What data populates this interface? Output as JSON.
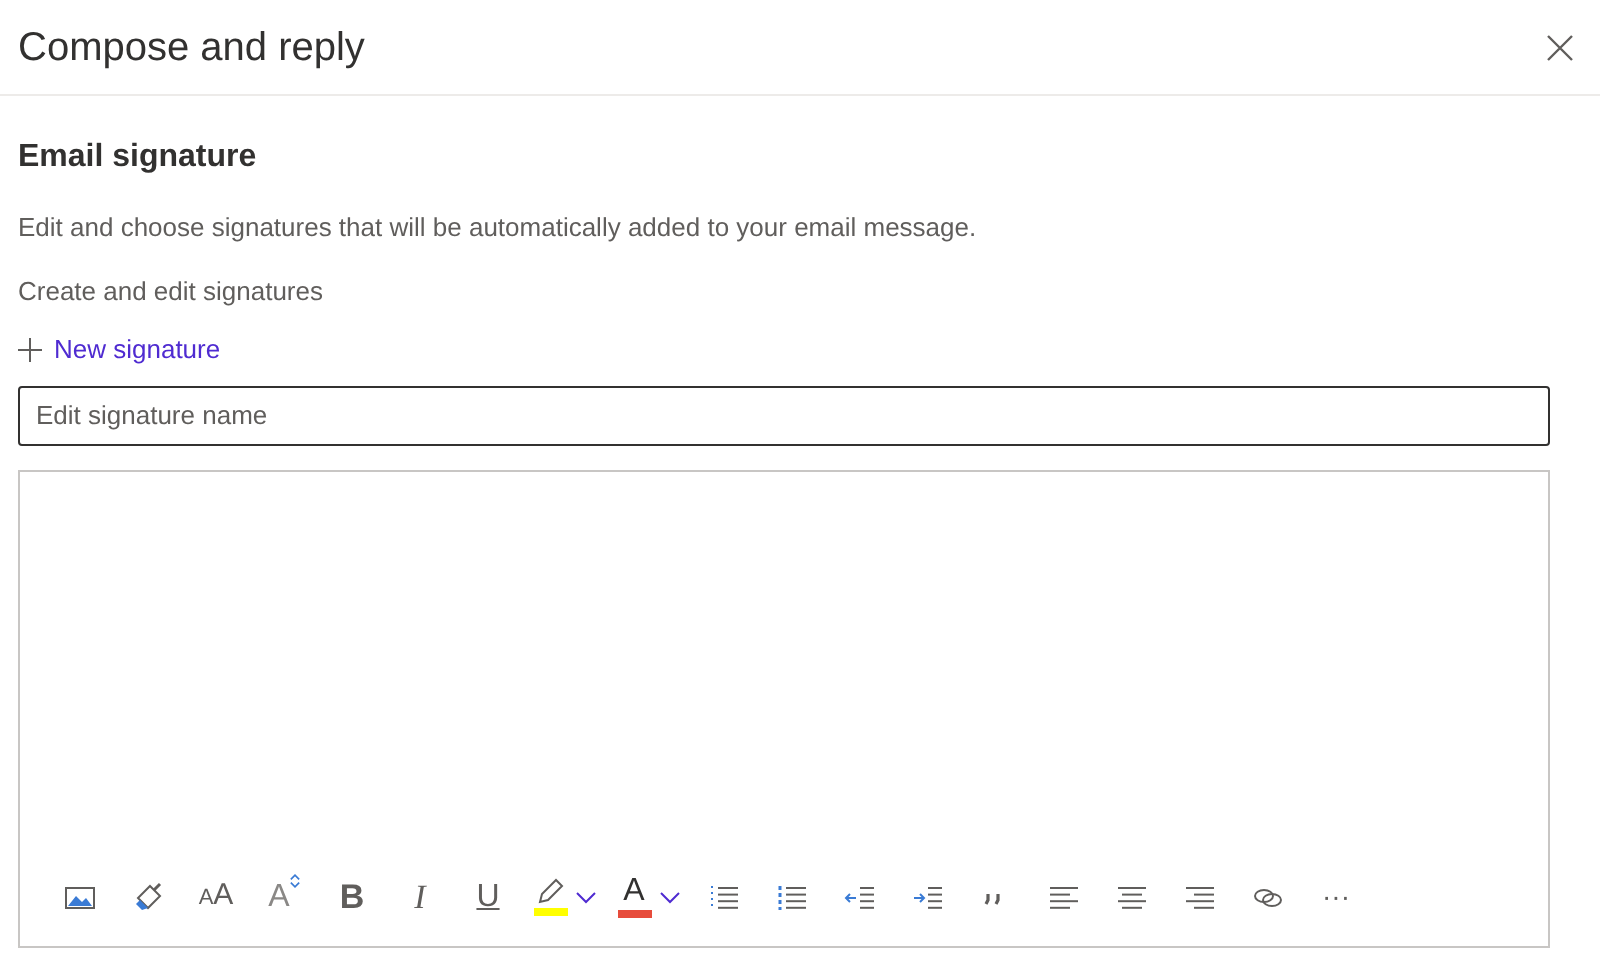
{
  "window": {
    "title": "Compose and reply"
  },
  "section": {
    "heading": "Email signature",
    "description": "Edit and choose signatures that will be automatically added to your email message.",
    "subheading": "Create and edit signatures",
    "new_link": "New signature"
  },
  "name_field": {
    "placeholder": "Edit signature name"
  },
  "toolbar": [
    {
      "kind": "picture"
    },
    {
      "kind": "painter"
    },
    {
      "kind": "font-size",
      "glyph": "AA"
    },
    {
      "kind": "grow",
      "glyph": "A"
    },
    {
      "kind": "bold",
      "glyph": "B"
    },
    {
      "kind": "italic",
      "glyph": "I"
    },
    {
      "kind": "underline",
      "glyph": "U"
    },
    {
      "kind": "highlight",
      "color": "#ffff00"
    },
    {
      "kind": "font-color",
      "glyph": "A",
      "color": "#e74c3c"
    },
    {
      "kind": "bullets"
    },
    {
      "kind": "numbering"
    },
    {
      "kind": "outdent"
    },
    {
      "kind": "indent"
    },
    {
      "kind": "quote"
    },
    {
      "kind": "align-left"
    },
    {
      "kind": "align-center"
    },
    {
      "kind": "align-right"
    },
    {
      "kind": "link"
    },
    {
      "kind": "more",
      "glyph": "···"
    }
  ]
}
